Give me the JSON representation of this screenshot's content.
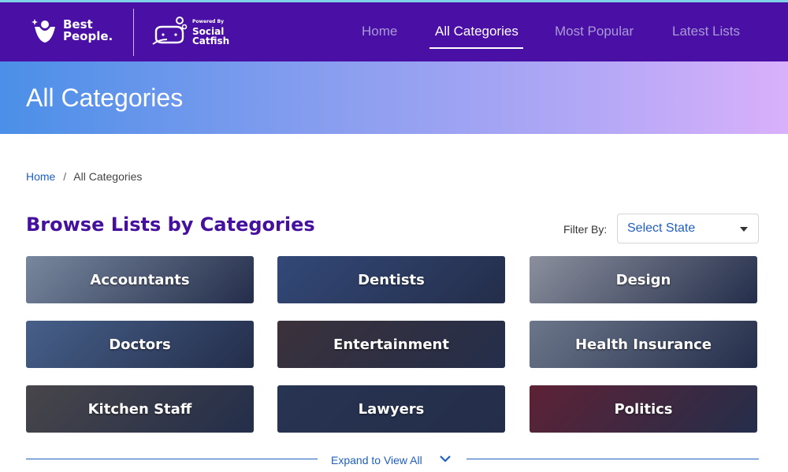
{
  "brand": {
    "best_line1": "Best",
    "best_line2": "People.",
    "sc_powered": "Powered By",
    "sc_line1": "Social",
    "sc_line2": "Catfish"
  },
  "nav": {
    "items": [
      {
        "label": "Home"
      },
      {
        "label": "All Categories"
      },
      {
        "label": "Most Popular"
      },
      {
        "label": "Latest Lists"
      }
    ],
    "active_index": 1
  },
  "banner": {
    "title": "All Categories"
  },
  "breadcrumb": {
    "home": "Home",
    "separator": "/",
    "current": "All Categories"
  },
  "section": {
    "title": "Browse Lists by Categories"
  },
  "filter": {
    "label": "Filter By:",
    "selected": "Select State"
  },
  "categories": [
    {
      "label": "Accountants",
      "color": "#9fb0c4"
    },
    {
      "label": "Dentists",
      "color": "#3f5a8f"
    },
    {
      "label": "Design",
      "color": "#b9bcc3"
    },
    {
      "label": "Doctors",
      "color": "#5a7aa8"
    },
    {
      "label": "Entertainment",
      "color": "#4a3a3a"
    },
    {
      "label": "Health Insurance",
      "color": "#8e99a8"
    },
    {
      "label": "Kitchen Staff",
      "color": "#5c5650"
    },
    {
      "label": "Lawyers",
      "color": "#2f3d5a"
    },
    {
      "label": "Politics",
      "color": "#7a2433"
    }
  ],
  "expand": {
    "label": "Expand to View All"
  },
  "colors": {
    "header_bg": "#4a0fa5",
    "accent_blue": "#1f5fbf",
    "title_purple": "#45109e"
  }
}
